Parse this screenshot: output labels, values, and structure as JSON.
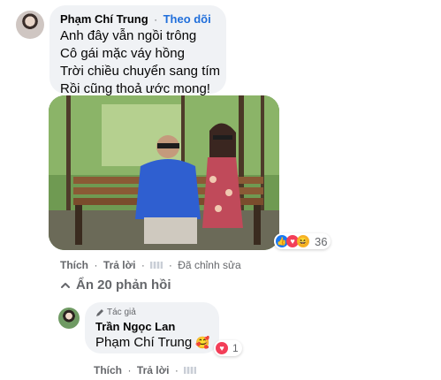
{
  "comment": {
    "author": "Phạm Chí Trung",
    "separator": "·",
    "follow_label": "Theo dõi",
    "lines": [
      "Anh đây vẫn ngồi trông",
      "Cô gái mặc váy hồng",
      "Trời chiều chuyển sang tím",
      "Rồi cũng thoả ước mong!"
    ],
    "reactions_count": "36",
    "like_label": "Thích",
    "reply_label": "Trả lời",
    "edited_label": "Đã chỉnh sửa",
    "dot": "·"
  },
  "replies_toggle": {
    "label": "Ẩn 20 phản hồi"
  },
  "reply": {
    "badge_label": "Tác giả",
    "author": "Trần Ngọc Lan",
    "mention": "Phạm Chí Trung",
    "emoji": "🥰",
    "reactions_count": "1",
    "like_label": "Thích",
    "reply_label": "Trả lời",
    "dot": "·"
  },
  "colors": {
    "bubble": "#f0f2f5",
    "link_blue": "#216fdb",
    "muted_text": "#65676b",
    "love_red": "#f33e58",
    "like_blue": "#1877f2",
    "haha_yellow": "#f7b125"
  },
  "icons": {
    "reactions": [
      "like-icon",
      "love-icon",
      "haha-icon"
    ],
    "collapse": "chevron-up-icon",
    "badge": "pencil-icon"
  }
}
